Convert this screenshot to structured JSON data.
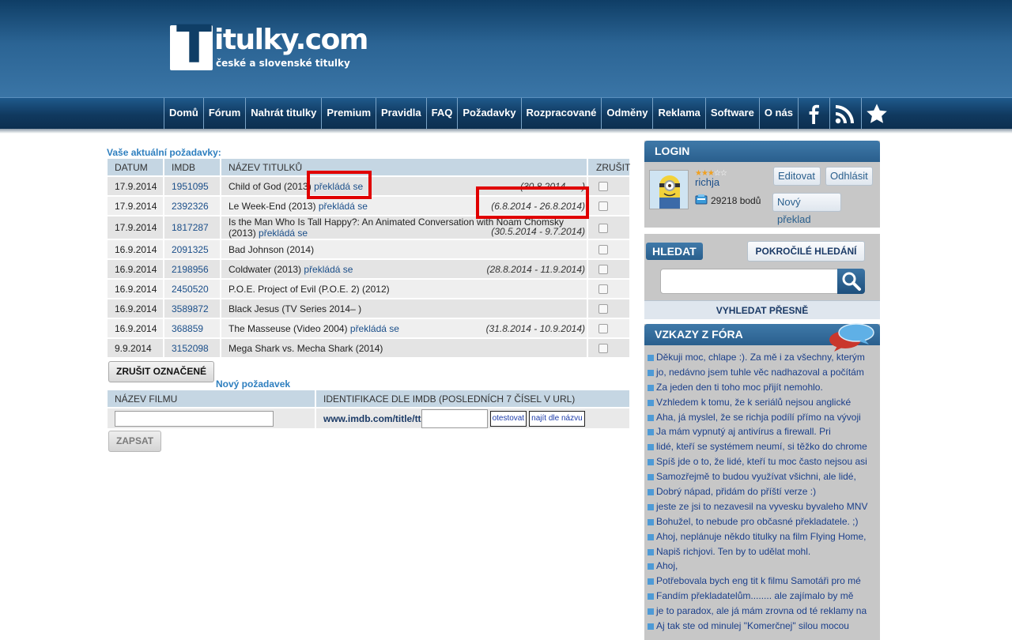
{
  "header": {
    "logo_letter": "T",
    "logo_text": "itulky.com",
    "logo_subtitle": "české a slovenské titulky"
  },
  "nav": [
    "Domů",
    "Fórum",
    "Nahrát titulky",
    "Premium",
    "Pravidla",
    "FAQ",
    "Požadavky",
    "Rozpracované",
    "Odměny",
    "Reklama",
    "Software",
    "O nás"
  ],
  "nav_icons": [
    "facebook-icon",
    "rss-icon",
    "star-icon"
  ],
  "requests": {
    "heading": "Vaše aktuální požadavky:",
    "columns": [
      "DATUM",
      "IMDB",
      "NÁZEV TITULKŮ",
      "ZRUŠIT"
    ],
    "rows": [
      {
        "date": "17.9.2014",
        "imdb": "1951095",
        "title": "Child of God (2013)",
        "status": "překládá se",
        "range": "(30.8.2014 - ...)"
      },
      {
        "date": "17.9.2014",
        "imdb": "2392326",
        "title": "Le Week-End (2013)",
        "status": "překládá se",
        "range": "(6.8.2014 - 26.8.2014)"
      },
      {
        "date": "17.9.2014",
        "imdb": "1817287",
        "title": "Is the Man Who Is Tall Happy?: An Animated Conversation with Noam Chomsky (2013)",
        "status": "překládá se",
        "range": "(30.5.2014 - 9.7.2014)"
      },
      {
        "date": "16.9.2014",
        "imdb": "2091325",
        "title": "Bad Johnson (2014)",
        "status": "",
        "range": ""
      },
      {
        "date": "16.9.2014",
        "imdb": "2198956",
        "title": "Coldwater (2013)",
        "status": "překládá se",
        "range": "(28.8.2014 - 11.9.2014)"
      },
      {
        "date": "16.9.2014",
        "imdb": "2450520",
        "title": "P.O.E. Project of Evil (P.O.E. 2) (2012)",
        "status": "",
        "range": ""
      },
      {
        "date": "16.9.2014",
        "imdb": "3589872",
        "title": "Black Jesus (TV Series 2014– )",
        "status": "",
        "range": ""
      },
      {
        "date": "16.9.2014",
        "imdb": "368859",
        "title": "The Masseuse (Video 2004)",
        "status": "překládá se",
        "range": "(31.8.2014 - 10.9.2014)"
      },
      {
        "date": "9.9.2014",
        "imdb": "3152098",
        "title": "Mega Shark vs. Mecha Shark (2014)",
        "status": "",
        "range": ""
      }
    ],
    "cancel_button": "ZRUŠIT OZNAČENÉ"
  },
  "new_request": {
    "heading": "Nový požadavek",
    "col_name": "NÁZEV FILMU",
    "col_imdb": "IDENTIFIKACE DLE IMDB (POSLEDNÍCH 7 ČÍSEL V URL)",
    "imdb_prefix": "www.imdb.com/title/tt",
    "test_button": "otestovat",
    "find_button": "najít dle názvu",
    "submit_button": "ZAPSAT"
  },
  "login": {
    "heading": "LOGIN",
    "username": "richja",
    "stars": "★★★",
    "stars_empty": "☆☆",
    "points": "29218 bodů",
    "edit_button": "Editovat",
    "logout_button": "Odhlásit",
    "new_translation_button": "Nový překlad"
  },
  "search": {
    "heading": "HLEDAT",
    "advanced_button": "POKROČILÉ HLEDÁNÍ",
    "exact_link": "VYHLEDAT PŘESNĚ"
  },
  "forum": {
    "heading": "VZKAZY Z FÓRA",
    "messages": [
      "Děkuji moc, chlape :). Za mě i za všechny, kterým",
      "jo, nedávno jsem tuhle věc nadhazoval a počítám",
      "Za jeden den ti toho moc přijít nemohlo.",
      "Vzhledem k tomu, že k seriálů nejsou anglické",
      "Aha, já myslel, že se richja podílí přímo na vývoji",
      "Ja mám vypnutý aj antivírus a firewall. Pri",
      "lidé, kteří se systémem neumí, si těžko do chrome",
      "Spíš jde o to, že lidé, kteří tu moc často nejsou asi",
      "Samozřejmě to budou využívat všichni, ale lidé,",
      "Dobrý nápad, přidám do příští verze :)",
      "jeste ze jsi to nezavesil na vyvesku byvaleho MNV",
      "Bohužel, to nebude pro občasné překladatele. ;)",
      "Ahoj, neplánuje někdo titulky na film Flying Home,",
      "Napiš richjovi. Ten by to udělat mohl.",
      "Ahoj,",
      "Potřebovala bych eng tit k filmu Samotáři pro mé",
      "Fandím překladatelům........ ale zajímalo by mě",
      "je to paradox, ale já mám zrovna od té reklamy na",
      "Aj tak ste od minulej \"Komerčnej\" silou mocou"
    ]
  },
  "colors": {
    "header_top": "#0f3e66",
    "nav_dark": "#10395f",
    "link": "#1b4f8a",
    "heading_blue": "#2e7fbf",
    "highlight_red": "#e00000"
  }
}
